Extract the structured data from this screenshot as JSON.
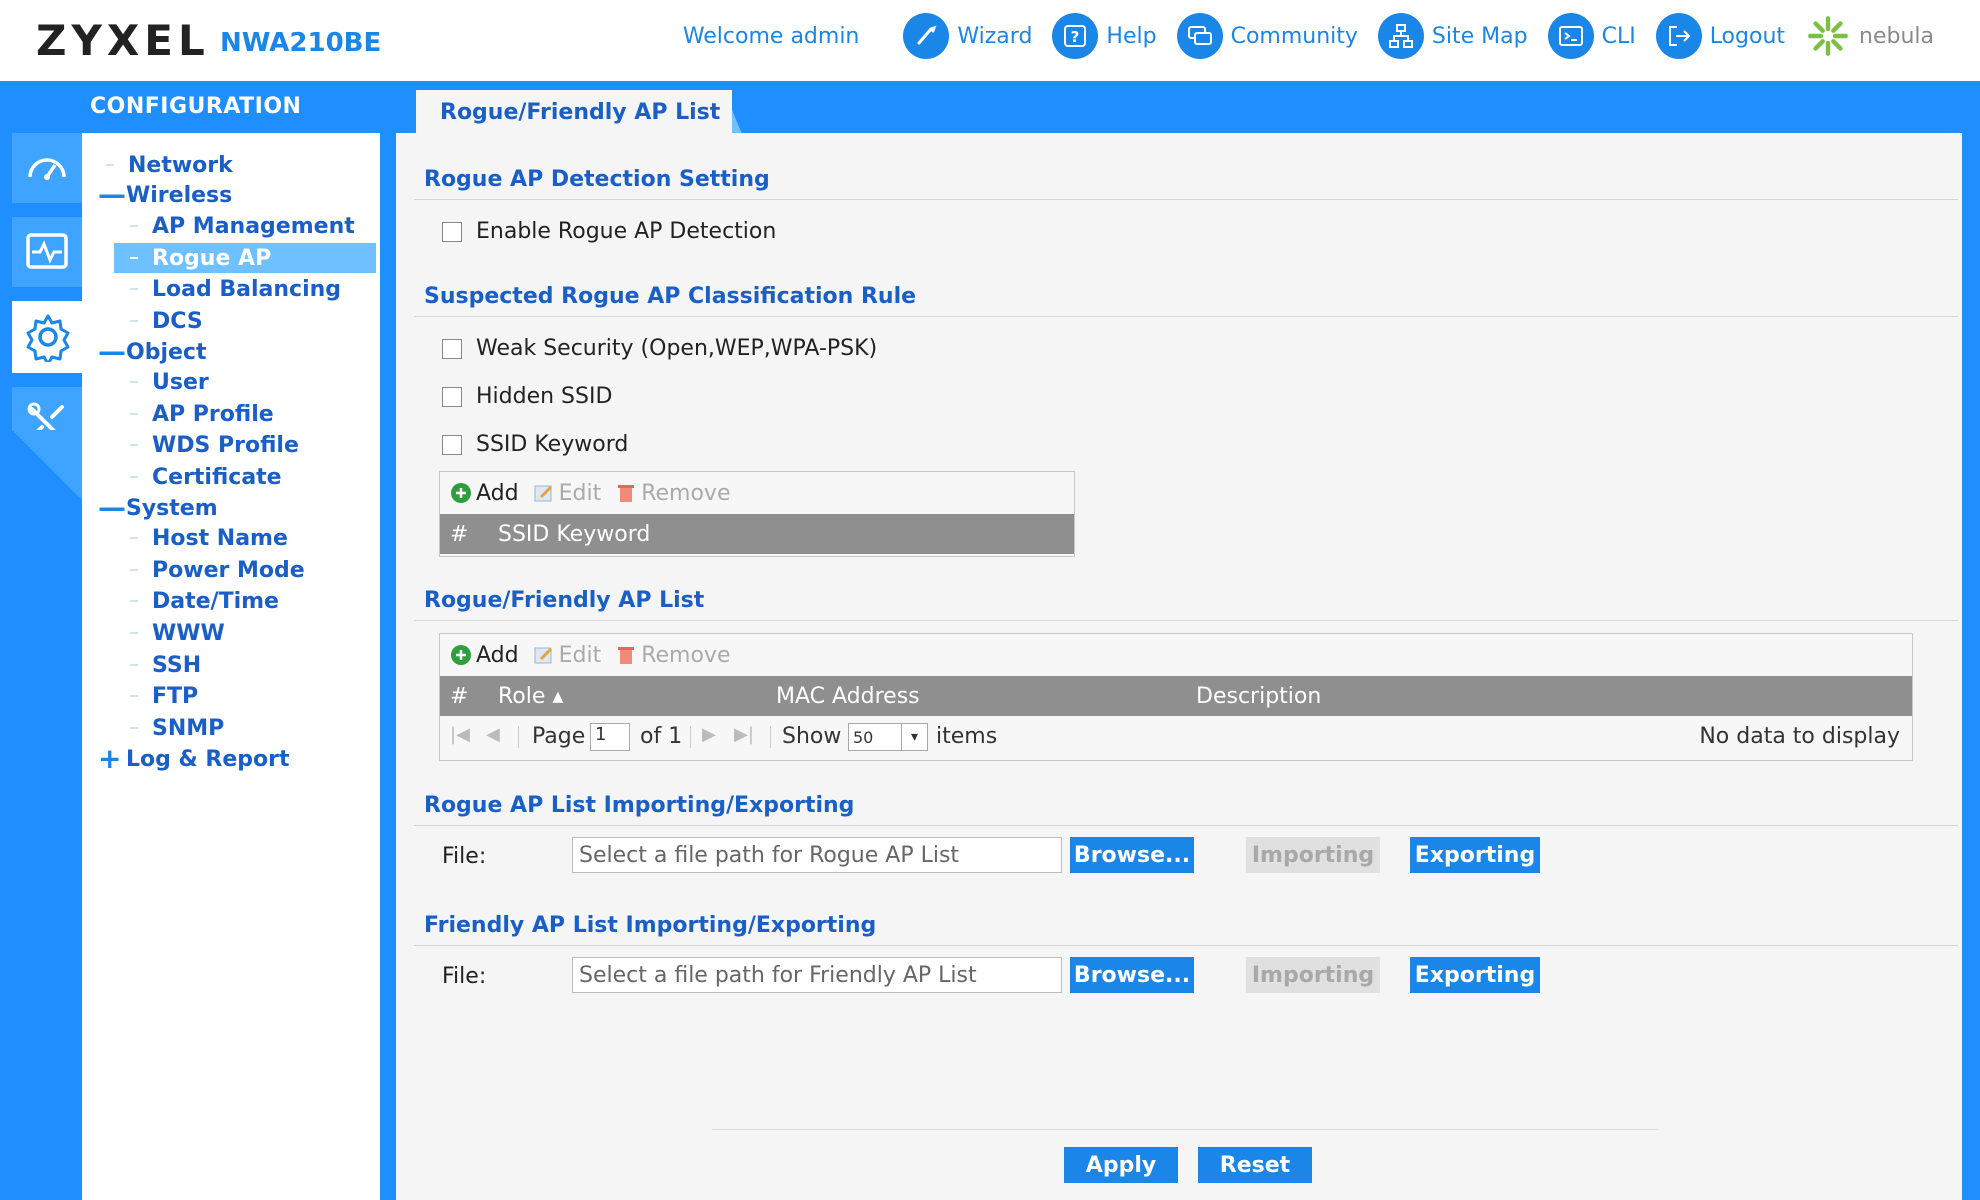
{
  "header": {
    "brand": "ZYXEL",
    "model": "NWA210BE",
    "welcome": "Welcome admin",
    "nav": [
      {
        "label": "Wizard",
        "icon": "wizard-icon"
      },
      {
        "label": "Help",
        "icon": "help-icon"
      },
      {
        "label": "Community",
        "icon": "community-icon"
      },
      {
        "label": "Site Map",
        "icon": "site-map-icon"
      },
      {
        "label": "CLI",
        "icon": "cli-icon"
      },
      {
        "label": "Logout",
        "icon": "logout-icon"
      },
      {
        "label": "nebula",
        "icon": "nebula-logo-icon"
      }
    ]
  },
  "sidebar": {
    "section_label": "CONFIGURATION",
    "icons": [
      "dashboard-icon",
      "monitor-icon",
      "gear-icon",
      "maintenance-icon"
    ],
    "tree": {
      "network": "Network",
      "wireless": "Wireless",
      "ap_management": "AP Management",
      "rogue_ap": "Rogue AP",
      "load_balancing": "Load Balancing",
      "dcs": "DCS",
      "object": "Object",
      "user": "User",
      "ap_profile": "AP Profile",
      "wds_profile": "WDS Profile",
      "certificate": "Certificate",
      "system": "System",
      "host_name": "Host Name",
      "power_mode": "Power Mode",
      "date_time": "Date/Time",
      "www": "WWW",
      "ssh": "SSH",
      "ftp": "FTP",
      "snmp": "SNMP",
      "log_report": "Log & Report"
    },
    "expand_minus": "—",
    "expand_plus": "+"
  },
  "tab": {
    "label": "Rogue/Friendly AP List"
  },
  "detection": {
    "title": "Rogue AP Detection Setting",
    "enable_label": "Enable Rogue AP Detection"
  },
  "classification": {
    "title": "Suspected Rogue AP Classification Rule",
    "weak_security": "Weak Security (Open,WEP,WPA-PSK)",
    "hidden_ssid": "Hidden SSID",
    "ssid_keyword": "SSID Keyword",
    "toolbar": {
      "add": "Add",
      "edit": "Edit",
      "remove": "Remove"
    },
    "columns": {
      "num": "#",
      "keyword": "SSID Keyword"
    }
  },
  "ap_list": {
    "title": "Rogue/Friendly AP List",
    "toolbar": {
      "add": "Add",
      "edit": "Edit",
      "remove": "Remove"
    },
    "columns": {
      "num": "#",
      "role": "Role ▴",
      "mac": "MAC Address",
      "description": "Description"
    },
    "pager": {
      "page_label": "Page",
      "page_value": "1",
      "of_label": "of 1",
      "show_label": "Show",
      "show_value": "50",
      "items_label": "items",
      "empty_text": "No data to display"
    }
  },
  "rogue_io": {
    "title": "Rogue AP List Importing/Exporting",
    "file_label": "File:",
    "placeholder": "Select a file path for Rogue AP List",
    "browse": "Browse...",
    "importing": "Importing",
    "exporting": "Exporting"
  },
  "friendly_io": {
    "title": "Friendly AP List Importing/Exporting",
    "file_label": "File:",
    "placeholder": "Select a file path for Friendly AP List",
    "browse": "Browse...",
    "importing": "Importing",
    "exporting": "Exporting"
  },
  "actions": {
    "apply": "Apply",
    "reset": "Reset"
  },
  "colors": {
    "accent": "#1a86e8",
    "sidebar_bg": "#1f8fff",
    "selected": "#6fc0ff",
    "header_text": "#1a5fc8",
    "grid_header": "#8f8f8f"
  }
}
